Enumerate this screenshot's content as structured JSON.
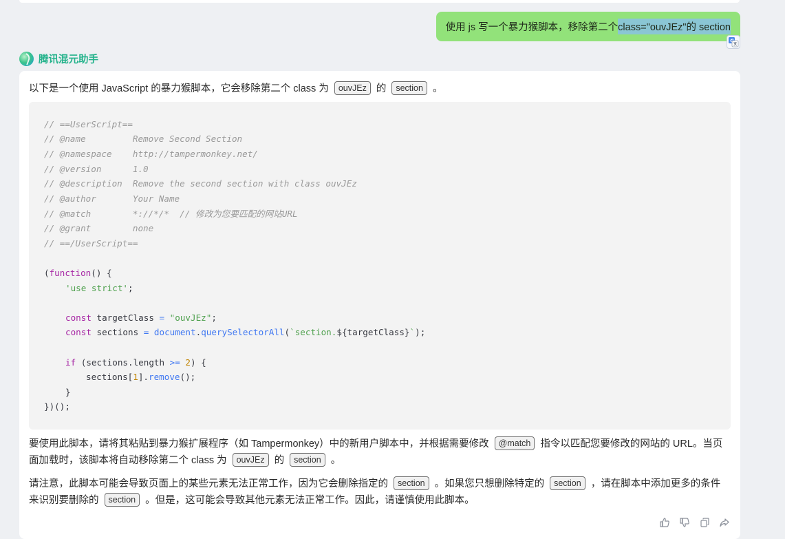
{
  "user_message": {
    "prefix": "使用 js 写一个暴力猴脚本，移除第二个",
    "selected_text": "class=\"ouvJEz\"的 section"
  },
  "assistant": {
    "name": "腾讯混元助手"
  },
  "answer": {
    "intro": {
      "t1": "以下是一个使用 JavaScript 的暴力猴脚本，它会移除第二个 class 为",
      "c1": "ouvJEz",
      "t2": "的",
      "c2": "section",
      "t3": "。"
    },
    "code": {
      "l1": "// ==UserScript==",
      "l2": "// @name         Remove Second Section",
      "l3": "// @namespace    http://tampermonkey.net/",
      "l4": "// @version      1.0",
      "l5": "// @description  Remove the second section with class ouvJEz",
      "l6": "// @author       Your Name",
      "l7": "// @match        *://*/*  // 修改为您要匹配的网站URL",
      "l8": "// @grant        none",
      "l9": "// ==/UserScript==",
      "l10_a": "(",
      "l10_kw": "function",
      "l10_b": "() {",
      "l11": "'use strict'",
      "l11_end": ";",
      "l12_kw": "const",
      "l12_var": " targetClass ",
      "l12_op": "=",
      "l12_str": " \"ouvJEz\"",
      "l12_end": ";",
      "l13_kw": "const",
      "l13_var": " sections ",
      "l13_op": "=",
      "l13_obj": " document",
      "l13_dot": ".",
      "l13_fn": "querySelectorAll",
      "l13_p1": "(",
      "l13_str": "`section.",
      "l13_tpl": "${targetClass}",
      "l13_str2": "`",
      "l13_end": ");",
      "l14_kw": "if",
      "l14_a": " (sections.length ",
      "l14_op": ">=",
      "l14_num": " 2",
      "l14_b": ") {",
      "l15_a": "sections[",
      "l15_num": "1",
      "l15_b": "].",
      "l15_fn": "remove",
      "l15_c": "();",
      "l16": "}",
      "l17": "})();"
    },
    "usage": {
      "t1": "要使用此脚本，请将其粘贴到暴力猴扩展程序（如 Tampermonkey）中的新用户脚本中，并根据需要修改",
      "c1": "@match",
      "t2": "指令以匹配您要修改的网站的 URL。当页面加载时，该脚本将自动移除第二个 class 为",
      "c2": "ouvJEz",
      "t3": "的",
      "c3": "section",
      "t4": "。"
    },
    "note": {
      "t1": "请注意，此脚本可能会导致页面上的某些元素无法正常工作，因为它会删除指定的",
      "c1": "section",
      "t2": "。如果您只想删除特定的",
      "c2": "section",
      "t3": "，请在脚本中添加更多的条件来识别要删除的",
      "c3": "section",
      "t4": "。但是，这可能会导致其他元素无法正常工作。因此，请谨慎使用此脚本。"
    }
  },
  "toolbar": {
    "icons": [
      "thumbs-up-icon",
      "thumbs-down-icon",
      "copy-icon",
      "share-icon"
    ]
  },
  "colors": {
    "user_bubble": "#92e27a",
    "selection": "#8ac6d4",
    "assistant_name": "#25b38c",
    "code_bg": "#f3f3f3"
  }
}
